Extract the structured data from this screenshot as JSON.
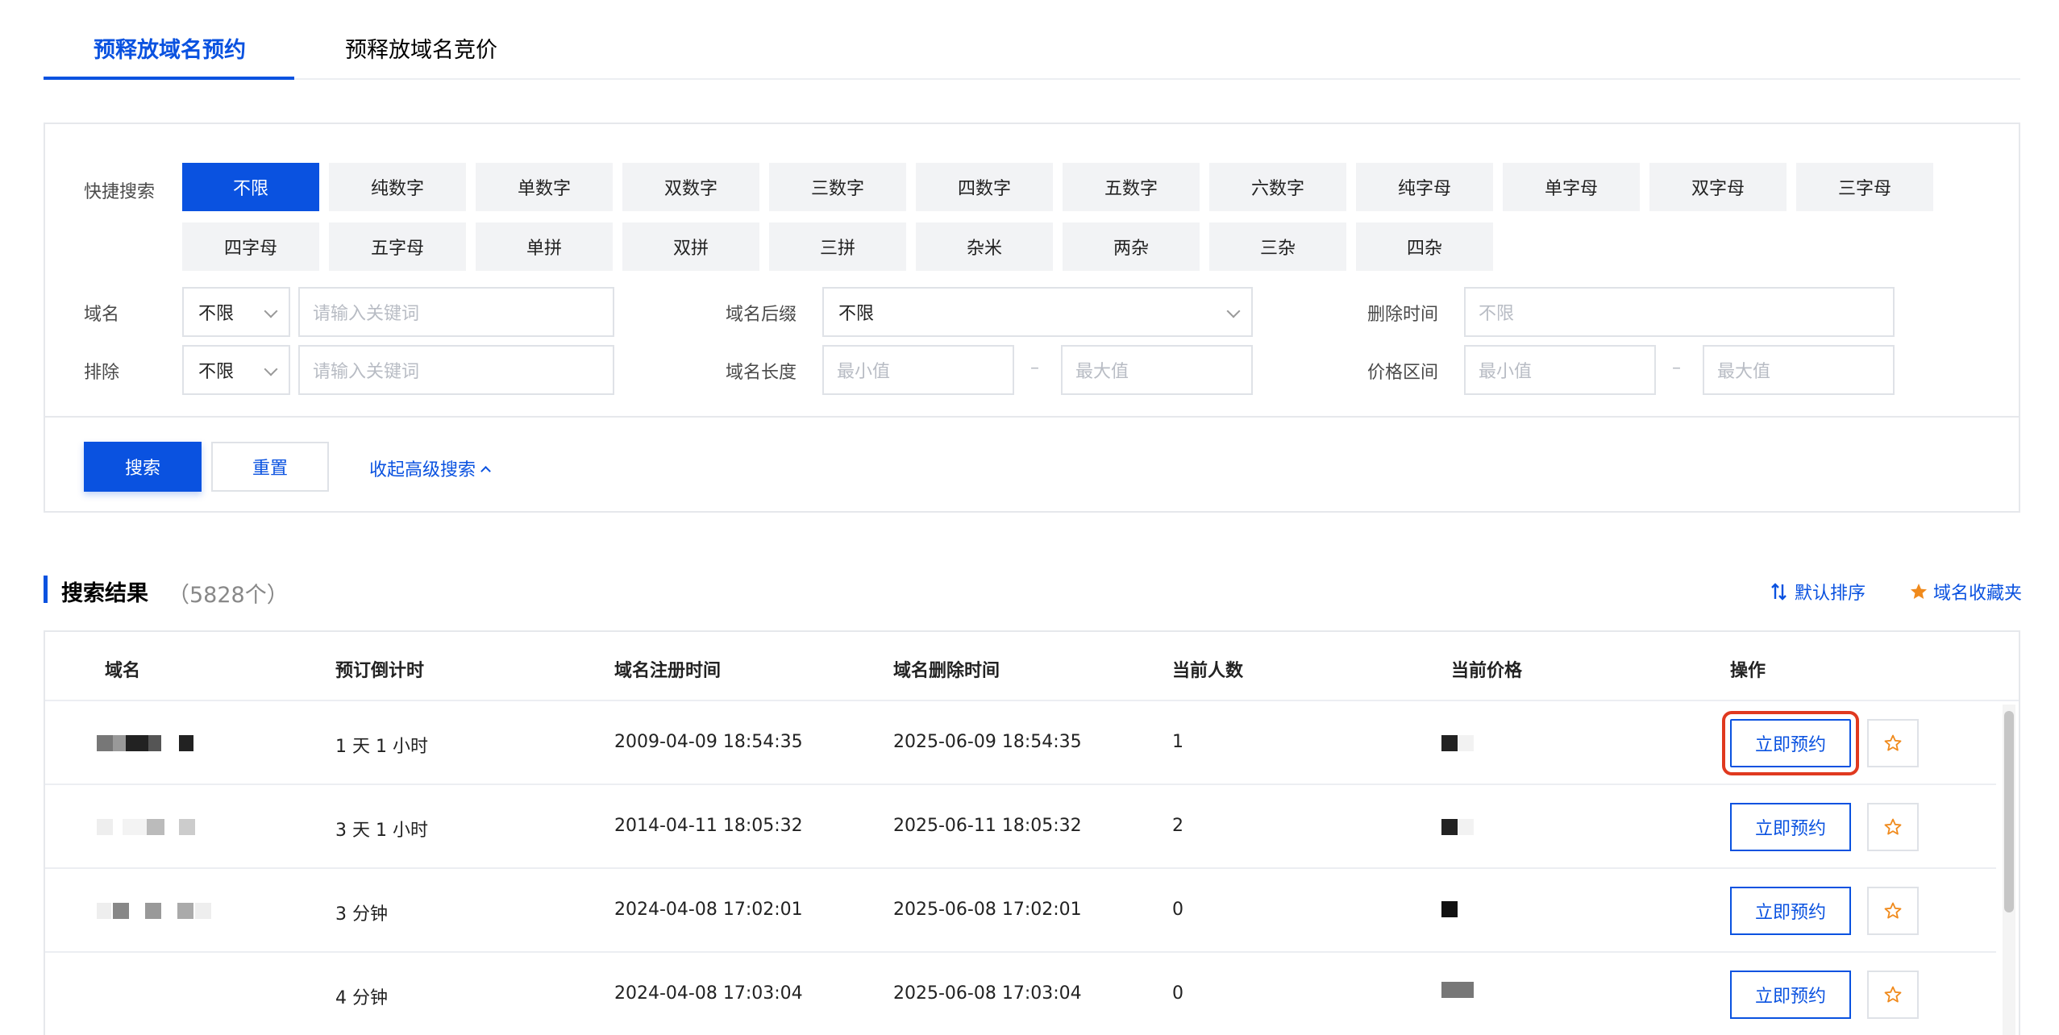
{
  "tabs": [
    {
      "label": "预释放域名预约",
      "active": true
    },
    {
      "label": "预释放域名竞价",
      "active": false
    }
  ],
  "filters": {
    "quick_label": "快捷搜索",
    "quick_chips": [
      "不限",
      "纯数字",
      "单数字",
      "双数字",
      "三数字",
      "四数字",
      "五数字",
      "六数字",
      "纯字母",
      "单字母",
      "双字母",
      "三字母",
      "四字母",
      "五字母",
      "单拼",
      "双拼",
      "三拼",
      "杂米",
      "两杂",
      "三杂",
      "四杂"
    ],
    "domain_label": "域名",
    "domain_select": "不限",
    "domain_placeholder": "请输入关键词",
    "exclude_label": "排除",
    "exclude_select": "不限",
    "exclude_placeholder": "请输入关键词",
    "suffix_label": "域名后缀",
    "suffix_select": "不限",
    "length_label": "域名长度",
    "length_min_placeholder": "最小值",
    "length_max_placeholder": "最大值",
    "delete_time_label": "删除时间",
    "delete_time_placeholder": "不限",
    "price_label": "价格区间",
    "price_min_placeholder": "最小值",
    "price_max_placeholder": "最大值",
    "range_separator": "–",
    "search_button": "搜索",
    "reset_button": "重置",
    "collapse_link": "收起高级搜索"
  },
  "results": {
    "title": "搜索结果",
    "count": "（5828个）",
    "sort_label": "默认排序",
    "favorites_label": "域名收藏夹"
  },
  "table": {
    "headers": [
      "域名",
      "预订倒计时",
      "域名注册时间",
      "域名删除时间",
      "当前人数",
      "当前价格",
      "操作"
    ],
    "rows": [
      {
        "countdown": "1 天 1 小时",
        "registered": "2009-04-09 18:54:35",
        "deleted": "2025-06-09 18:54:35",
        "count": "1",
        "action": "立即预约"
      },
      {
        "countdown": "3 天 1 小时",
        "registered": "2014-04-11 18:05:32",
        "deleted": "2025-06-11 18:05:32",
        "count": "2",
        "action": "立即预约"
      },
      {
        "countdown": "3 分钟",
        "registered": "2024-04-08 17:02:01",
        "deleted": "2025-06-08 17:02:01",
        "count": "0",
        "action": "立即预约"
      },
      {
        "countdown": "4 分钟",
        "registered": "2024-04-08 17:03:04",
        "deleted": "2025-06-08 17:03:04",
        "count": "0",
        "action": "立即预约"
      }
    ]
  },
  "colors": {
    "primary": "#0a52e0",
    "highlight": "#e0391f",
    "star": "#f08a1c"
  }
}
